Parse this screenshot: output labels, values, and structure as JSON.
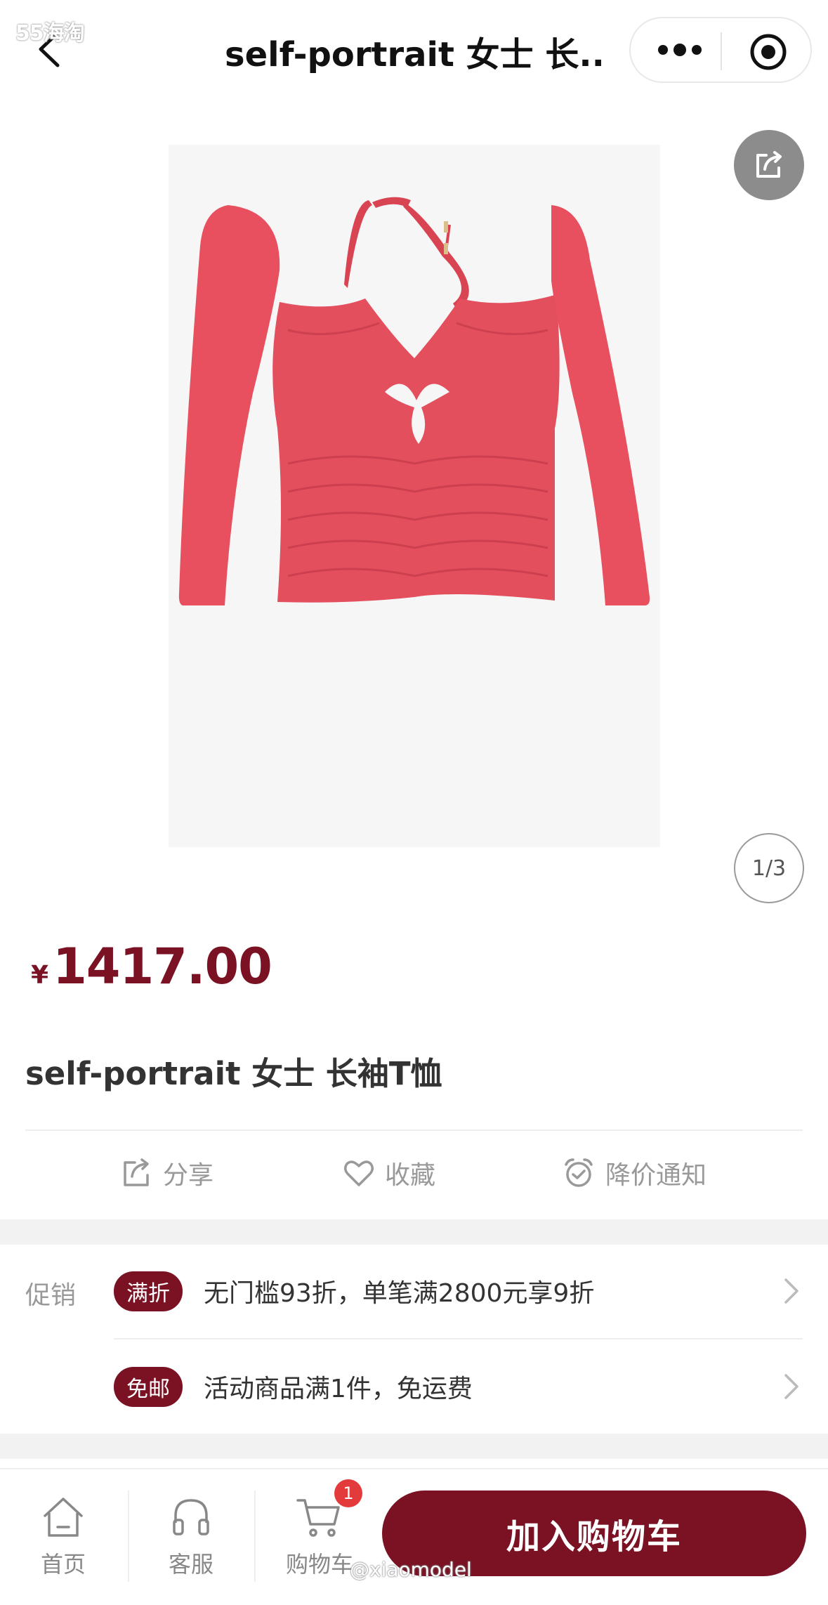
{
  "watermark": {
    "top": "55海淘",
    "bottom": "@xiaomodel"
  },
  "nav": {
    "title": "self-portrait 女士 长..."
  },
  "gallery": {
    "pager": "1/3",
    "product_color": "#e8505f"
  },
  "product": {
    "currency": "¥",
    "price": "1417.00",
    "title": "self-portrait 女士 长袖T恤"
  },
  "actions": [
    {
      "label": "分享",
      "icon": "share-icon"
    },
    {
      "label": "收藏",
      "icon": "heart-icon"
    },
    {
      "label": "降价通知",
      "icon": "alarm-clock-icon"
    }
  ],
  "promotions": {
    "label": "促销",
    "items": [
      {
        "badge": "满折",
        "text": "无门槛93折，单笔满2800元享9折"
      },
      {
        "badge": "免邮",
        "text": "活动商品满1件，免运费"
      }
    ]
  },
  "tabbar": {
    "items": [
      {
        "label": "首页",
        "icon": "home-icon"
      },
      {
        "label": "客服",
        "icon": "headset-icon"
      },
      {
        "label": "购物车",
        "icon": "cart-icon",
        "badge": "1"
      }
    ],
    "add_to_cart": "加入购物车"
  },
  "colors": {
    "accent": "#7a1224",
    "badge_red": "#e33b3b"
  }
}
